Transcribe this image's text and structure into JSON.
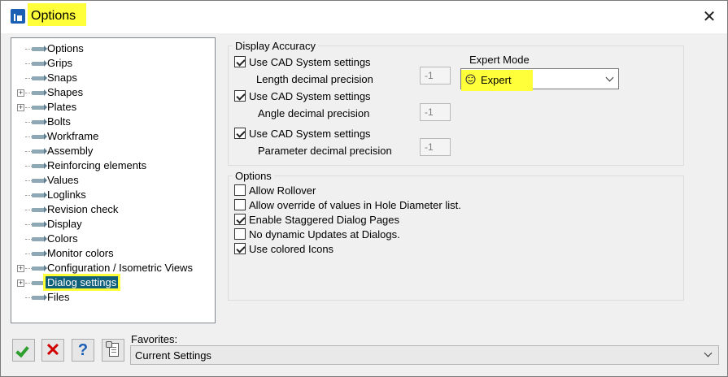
{
  "window": {
    "title": "Options",
    "close_glyph": "✕"
  },
  "tree": {
    "items": [
      {
        "label": "Options",
        "expandable": false
      },
      {
        "label": "Grips",
        "expandable": false
      },
      {
        "label": "Snaps",
        "expandable": false
      },
      {
        "label": "Shapes",
        "expandable": true
      },
      {
        "label": "Plates",
        "expandable": true
      },
      {
        "label": "Bolts",
        "expandable": false
      },
      {
        "label": "Workframe",
        "expandable": false
      },
      {
        "label": "Assembly",
        "expandable": false
      },
      {
        "label": "Reinforcing elements",
        "expandable": false
      },
      {
        "label": "Values",
        "expandable": false
      },
      {
        "label": "Loglinks",
        "expandable": false
      },
      {
        "label": "Revision check",
        "expandable": false
      },
      {
        "label": "Display",
        "expandable": false
      },
      {
        "label": "Colors",
        "expandable": false
      },
      {
        "label": "Monitor colors",
        "expandable": false
      },
      {
        "label": "Configuration / Isometric Views",
        "expandable": true
      },
      {
        "label": "Dialog settings",
        "expandable": true,
        "selected": true
      },
      {
        "label": "Files",
        "expandable": false
      }
    ]
  },
  "display_accuracy": {
    "title": "Display Accuracy",
    "length": {
      "checkbox_label": "Use CAD System settings",
      "checked": true,
      "precision_label": "Length decimal precision",
      "value": "-1"
    },
    "angle": {
      "checkbox_label": "Use CAD System settings",
      "checked": true,
      "precision_label": "Angle decimal precision",
      "value": "-1"
    },
    "parameter": {
      "checkbox_label": "Use CAD System settings",
      "checked": true,
      "precision_label": "Parameter decimal precision",
      "value": "-1"
    }
  },
  "expert_mode": {
    "label": "Expert Mode",
    "value": "Expert",
    "icon": "smiley-icon"
  },
  "options": {
    "title": "Options",
    "items": [
      {
        "label": "Allow Rollover",
        "checked": false
      },
      {
        "label": "Allow override of values in Hole Diameter list.",
        "checked": false
      },
      {
        "label": "Enable Staggered Dialog Pages",
        "checked": true
      },
      {
        "label": "No dynamic Updates at Dialogs.",
        "checked": false
      },
      {
        "label": "Use colored Icons",
        "checked": true
      }
    ]
  },
  "toolbar": {
    "ok_glyph": "✓",
    "cancel_glyph": "✕",
    "help_glyph": "?"
  },
  "favorites": {
    "label": "Favorites:",
    "value": "Current Settings"
  },
  "colors": {
    "highlight": "#ffff3a",
    "selection": "#0f5f7a",
    "accent": "#1a5fb4"
  }
}
